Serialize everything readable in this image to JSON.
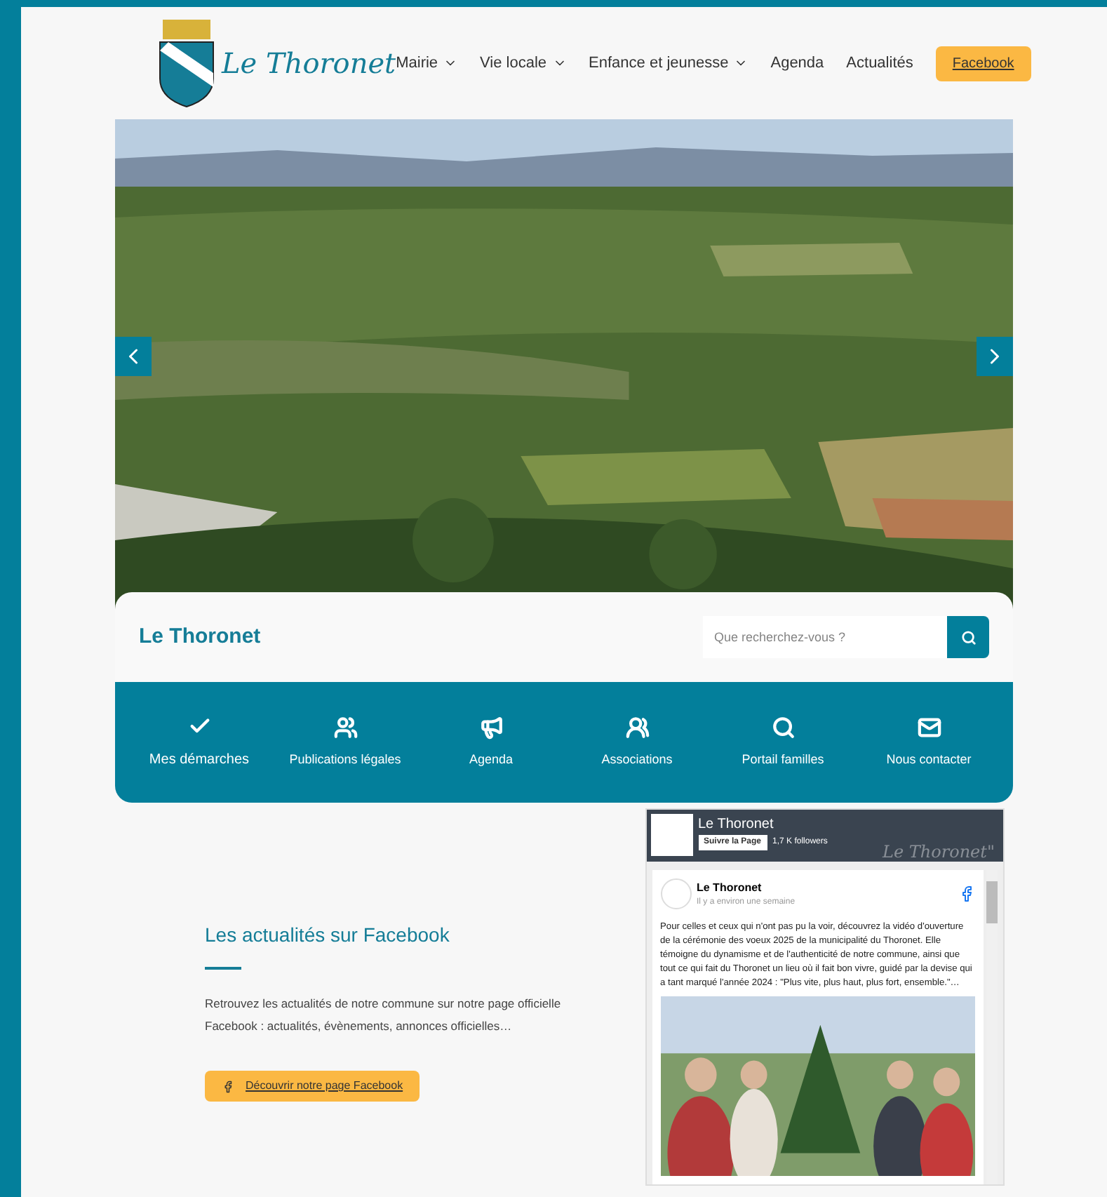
{
  "header": {
    "logo_text": "Le Thoronet",
    "nav": [
      {
        "label": "Mairie",
        "dropdown": true
      },
      {
        "label": "Vie locale",
        "dropdown": true
      },
      {
        "label": "Enfance et jeunesse",
        "dropdown": true
      },
      {
        "label": "Agenda",
        "dropdown": false
      },
      {
        "label": "Actualités",
        "dropdown": false
      }
    ],
    "cta": "Facebook"
  },
  "search_card": {
    "title": "Le Thoronet",
    "placeholder": "Que recherchez-vous ?"
  },
  "quick_links": [
    {
      "label": "Mes démarches"
    },
    {
      "label": "Publications légales"
    },
    {
      "label": "Agenda"
    },
    {
      "label": "Associations"
    },
    {
      "label": "Portail familles"
    },
    {
      "label": "Nous contacter"
    }
  ],
  "facebook_section": {
    "title": "Les actualités sur Facebook",
    "text": "Retrouvez les actualités de notre commune sur notre page officielle Facebook : actualités, évènements, annonces officielles…",
    "button": "Découvrir notre page Facebook"
  },
  "facebook_widget": {
    "page_name": "Le Thoronet",
    "follow": "Suivre la Page",
    "followers": "1,7 K followers",
    "cover_text": "Le Thoronet\"",
    "post_author": "Le Thoronet",
    "post_time": "Il y a environ une semaine",
    "post_text": "Pour celles et ceux qui n'ont pas pu la voir, découvrez la vidéo d'ouverture de la cérémonie des voeux 2025 de la municipalité du Thoronet. Elle témoigne du dynamisme et de l'authenticité de notre commune, ainsi que tout ce qui fait du Thoronet un lieu où il fait bon vivre, guidé par la devise qui a tant marqué l'année 2024 : \"Plus vite, plus haut, plus fort, ensemble.\"…"
  }
}
